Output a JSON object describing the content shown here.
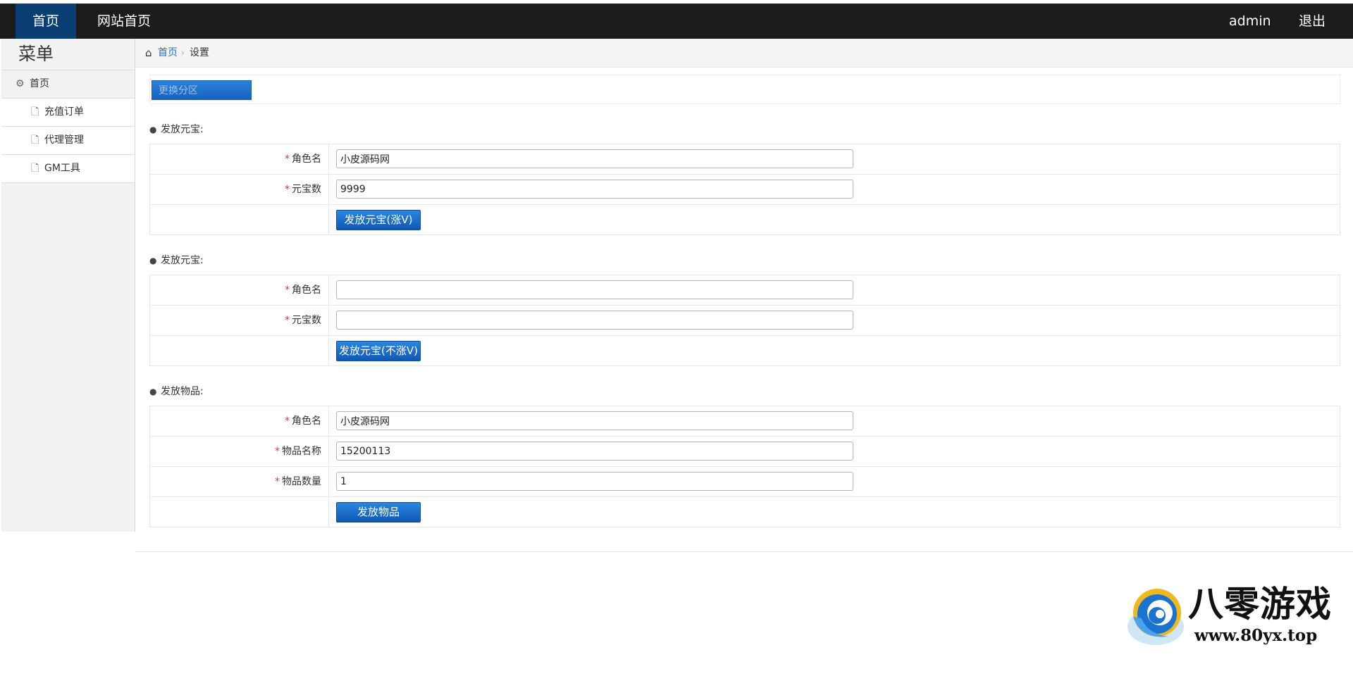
{
  "topnav": {
    "home": "首页",
    "site_home": "网站首页",
    "user": "admin",
    "logout": "退出"
  },
  "sidebar": {
    "title": "菜单",
    "items": [
      {
        "label": "首页",
        "icon": "gear-icon"
      },
      {
        "label": "充值订单",
        "icon": "file-icon"
      },
      {
        "label": "代理管理",
        "icon": "file-icon"
      },
      {
        "label": "GM工具",
        "icon": "file-icon"
      }
    ]
  },
  "breadcrumb": {
    "home": "首页",
    "current": "设置"
  },
  "toolbar": {
    "change_server": "更换分区"
  },
  "sections": [
    {
      "title": "发放元宝:",
      "fields": [
        {
          "label": "角色名",
          "value": "小皮源码网"
        },
        {
          "label": "元宝数",
          "value": "9999"
        }
      ],
      "button": "发放元宝(涨V)"
    },
    {
      "title": "发放元宝:",
      "fields": [
        {
          "label": "角色名",
          "value": ""
        },
        {
          "label": "元宝数",
          "value": ""
        }
      ],
      "button": "发放元宝(不涨V)"
    },
    {
      "title": "发放物品:",
      "fields": [
        {
          "label": "角色名",
          "value": "小皮源码网"
        },
        {
          "label": "物品名称",
          "value": "15200113"
        },
        {
          "label": "物品数量",
          "value": "1"
        }
      ],
      "button": "发放物品"
    }
  ],
  "watermark": {
    "name": "八零游戏",
    "url": "www.80yx.top"
  },
  "colors": {
    "topbar": "#1c1c1c",
    "nav_active": "#0b3f74",
    "button": "#1563be",
    "required": "#ee3333"
  }
}
